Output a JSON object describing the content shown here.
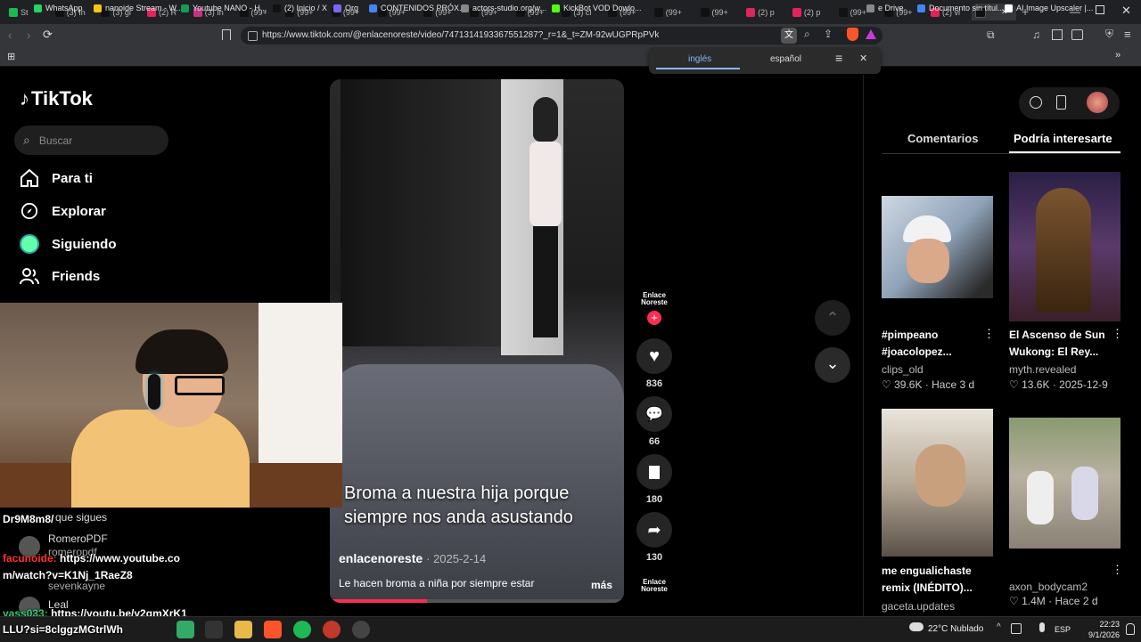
{
  "browser": {
    "url": "https://www.tiktok.com/@enlacenoreste/video/7471314193367551287?_r=1&_t=ZM-92wUGPRpPVk",
    "tabs": [
      {
        "label": "St",
        "color": "#1db954"
      },
      {
        "label": "(3) In",
        "color": "#111"
      },
      {
        "label": "(3) gi",
        "color": "#111"
      },
      {
        "label": "(2) R",
        "color": "#e0245e"
      },
      {
        "label": "(3) In",
        "color": "#c13584"
      },
      {
        "label": "(99+",
        "color": "#111"
      },
      {
        "label": "(99+",
        "color": "#111"
      },
      {
        "label": "(99+",
        "color": "#111"
      },
      {
        "label": "(99+",
        "color": "#111"
      },
      {
        "label": "(99+",
        "color": "#111"
      },
      {
        "label": "(99+",
        "color": "#111"
      },
      {
        "label": "(99+",
        "color": "#111"
      },
      {
        "label": "(3) cl",
        "color": "#111"
      },
      {
        "label": "(99+",
        "color": "#111"
      },
      {
        "label": "(99+",
        "color": "#111"
      },
      {
        "label": "(99+",
        "color": "#111"
      },
      {
        "label": "(2) p",
        "color": "#e0245e"
      },
      {
        "label": "(2) p",
        "color": "#e0245e"
      },
      {
        "label": "(99+",
        "color": "#111"
      },
      {
        "label": "(99+",
        "color": "#111"
      },
      {
        "label": "(2) vi",
        "color": "#e0245e"
      }
    ],
    "bookmarks": [
      {
        "label": "WhatsApp",
        "color": "#25d366"
      },
      {
        "label": "nanoide Stream - W...",
        "color": "#f5c518"
      },
      {
        "label": "Youtube NANO - H...",
        "color": "#0f9d58"
      },
      {
        "label": "(2) Inicio / X",
        "color": "#111"
      },
      {
        "label": "Org",
        "color": "#7b68ee"
      },
      {
        "label": "CONTENIDOS PRÓX...",
        "color": "#4285f4"
      },
      {
        "label": "actors-studio.org/w...",
        "color": "#888"
      },
      {
        "label": "KickBot VOD Dowlo...",
        "color": "#53fc18"
      },
      {
        "label": "e Drive",
        "color": "#888"
      },
      {
        "label": "Documento sin títul...",
        "color": "#4285f4"
      },
      {
        "label": "AI Image Upscaler |...",
        "color": "#fff"
      }
    ],
    "translate": {
      "lang_from": "inglés",
      "lang_to": "español"
    }
  },
  "tiktok": {
    "logo": "TikTok",
    "search_placeholder": "Buscar",
    "nav": [
      {
        "label": "Para ti",
        "icon": "home-icon"
      },
      {
        "label": "Explorar",
        "icon": "compass-icon"
      },
      {
        "label": "Siguiendo",
        "icon": "avatar-icon"
      },
      {
        "label": "Friends",
        "icon": "friends-icon"
      }
    ],
    "video": {
      "caption_overlay_line1": "Broma a nuestra hija porque",
      "caption_overlay_line2": "siempre nos anda asustando",
      "author": "enlacenoreste",
      "date": "· 2025-2-14",
      "description": "Le hacen broma a niña por siempre estar",
      "more": "más",
      "channel_badge": "Enlace Noreste",
      "progress": 0.33
    },
    "actions": {
      "likes": "836",
      "comments": "66",
      "saves": "180",
      "shares": "130"
    },
    "panel": {
      "tab_comments": "Comentarios",
      "tab_suggestions": "Podría interesarte",
      "cards": [
        {
          "title1": "#pimpeano",
          "title2": "#joacolopez...",
          "author": "clips_old",
          "likes": "39.6K",
          "date": "· Hace 3 d"
        },
        {
          "title1": "El Ascenso de Sun",
          "title2": "Wukong: El Rey...",
          "author": "myth.revealed",
          "likes": "13.6K",
          "date": "· 2025-12-9"
        },
        {
          "title1": "me engualichaste",
          "title2": "remix (INÉDITO)...",
          "author": "gaceta.updates",
          "likes": "",
          "date": ""
        },
        {
          "title1": "",
          "title2": "",
          "author": "axon_bodycam2",
          "likes": "1.4M",
          "date": "· Hace 2 d"
        }
      ]
    }
  },
  "chat": {
    "lines": [
      {
        "text": "Dr9M8m8/"
      },
      {
        "text": "que sigues"
      },
      {
        "text": "RomeroPDF"
      },
      {
        "text": "romeropdf"
      },
      {
        "user": "facunoide:",
        "text": "https://www.youtube.co"
      },
      {
        "text": "m/watch?v=K1Nj_1RaeZ8"
      },
      {
        "text": "sevenkayne"
      },
      {
        "text": "Leal"
      },
      {
        "user": "yass033:",
        "text": "https://youtu.be/y2gmXrK1"
      },
      {
        "text": "LLU?si=8clggzMGtrlWh"
      }
    ]
  },
  "taskbar": {
    "weather": "22°C  Nublado",
    "lang": "ESP",
    "time": "22:23",
    "date": "9/1/2026"
  }
}
